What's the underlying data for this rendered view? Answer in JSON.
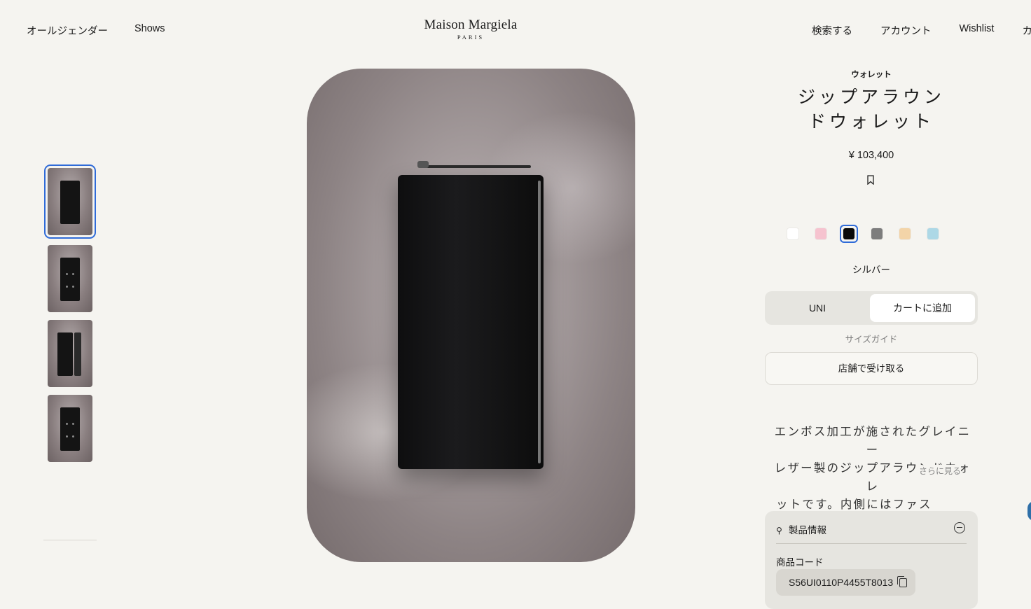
{
  "header": {
    "nav_left": [
      "オールジェンダー",
      "Shows"
    ],
    "logo_brand": "Maison Margiela",
    "logo_city": "PARIS",
    "nav_right": [
      "検索する",
      "アカウント",
      "Wishlist",
      "カ"
    ]
  },
  "gallery": {
    "thumbnails": [
      {
        "icon": "wallet-front-thumbnail",
        "active": true
      },
      {
        "icon": "wallet-back-stitches-thumbnail",
        "active": false
      },
      {
        "icon": "wallet-open-thumbnail",
        "active": false
      },
      {
        "icon": "wallet-back-stitches-thumbnail",
        "active": false
      }
    ]
  },
  "product": {
    "category": "ウォレット",
    "title_line1": "ジップアラウン",
    "title_line2": "ドウォレット",
    "price": "¥ 103,400",
    "bookmark_icon": "bookmark-icon",
    "swatches": [
      {
        "name": "white",
        "color": "#ffffff",
        "selected": false
      },
      {
        "name": "pink",
        "color": "#f6c3cf",
        "selected": false
      },
      {
        "name": "black",
        "color": "#0a0a0a",
        "selected": true
      },
      {
        "name": "grey",
        "color": "#7d7d7d",
        "selected": false
      },
      {
        "name": "beige",
        "color": "#f3d4a8",
        "selected": false
      },
      {
        "name": "light-blue",
        "color": "#add8e6",
        "selected": false
      }
    ],
    "color_name": "シルバー",
    "size": "UNI",
    "add_to_cart": "カートに追加",
    "size_guide": "サイズガイド",
    "store_pickup": "店舗で受け取る",
    "description_line1": "エンボス加工が施されたグレイニー",
    "description_line2": "レザー製のジップアラウンドウォレ",
    "description_line3": "ットです。内側にはファス",
    "see_more": "さらに見る",
    "info_title": "製品情報",
    "info_icon": "hanger-icon",
    "code_label": "商品コード",
    "product_code": "S56UI0110P4455T8013"
  },
  "colors": {
    "accent": "#2f6bd8",
    "background": "#f5f4f0",
    "panel_grey": "#e6e5e0"
  }
}
